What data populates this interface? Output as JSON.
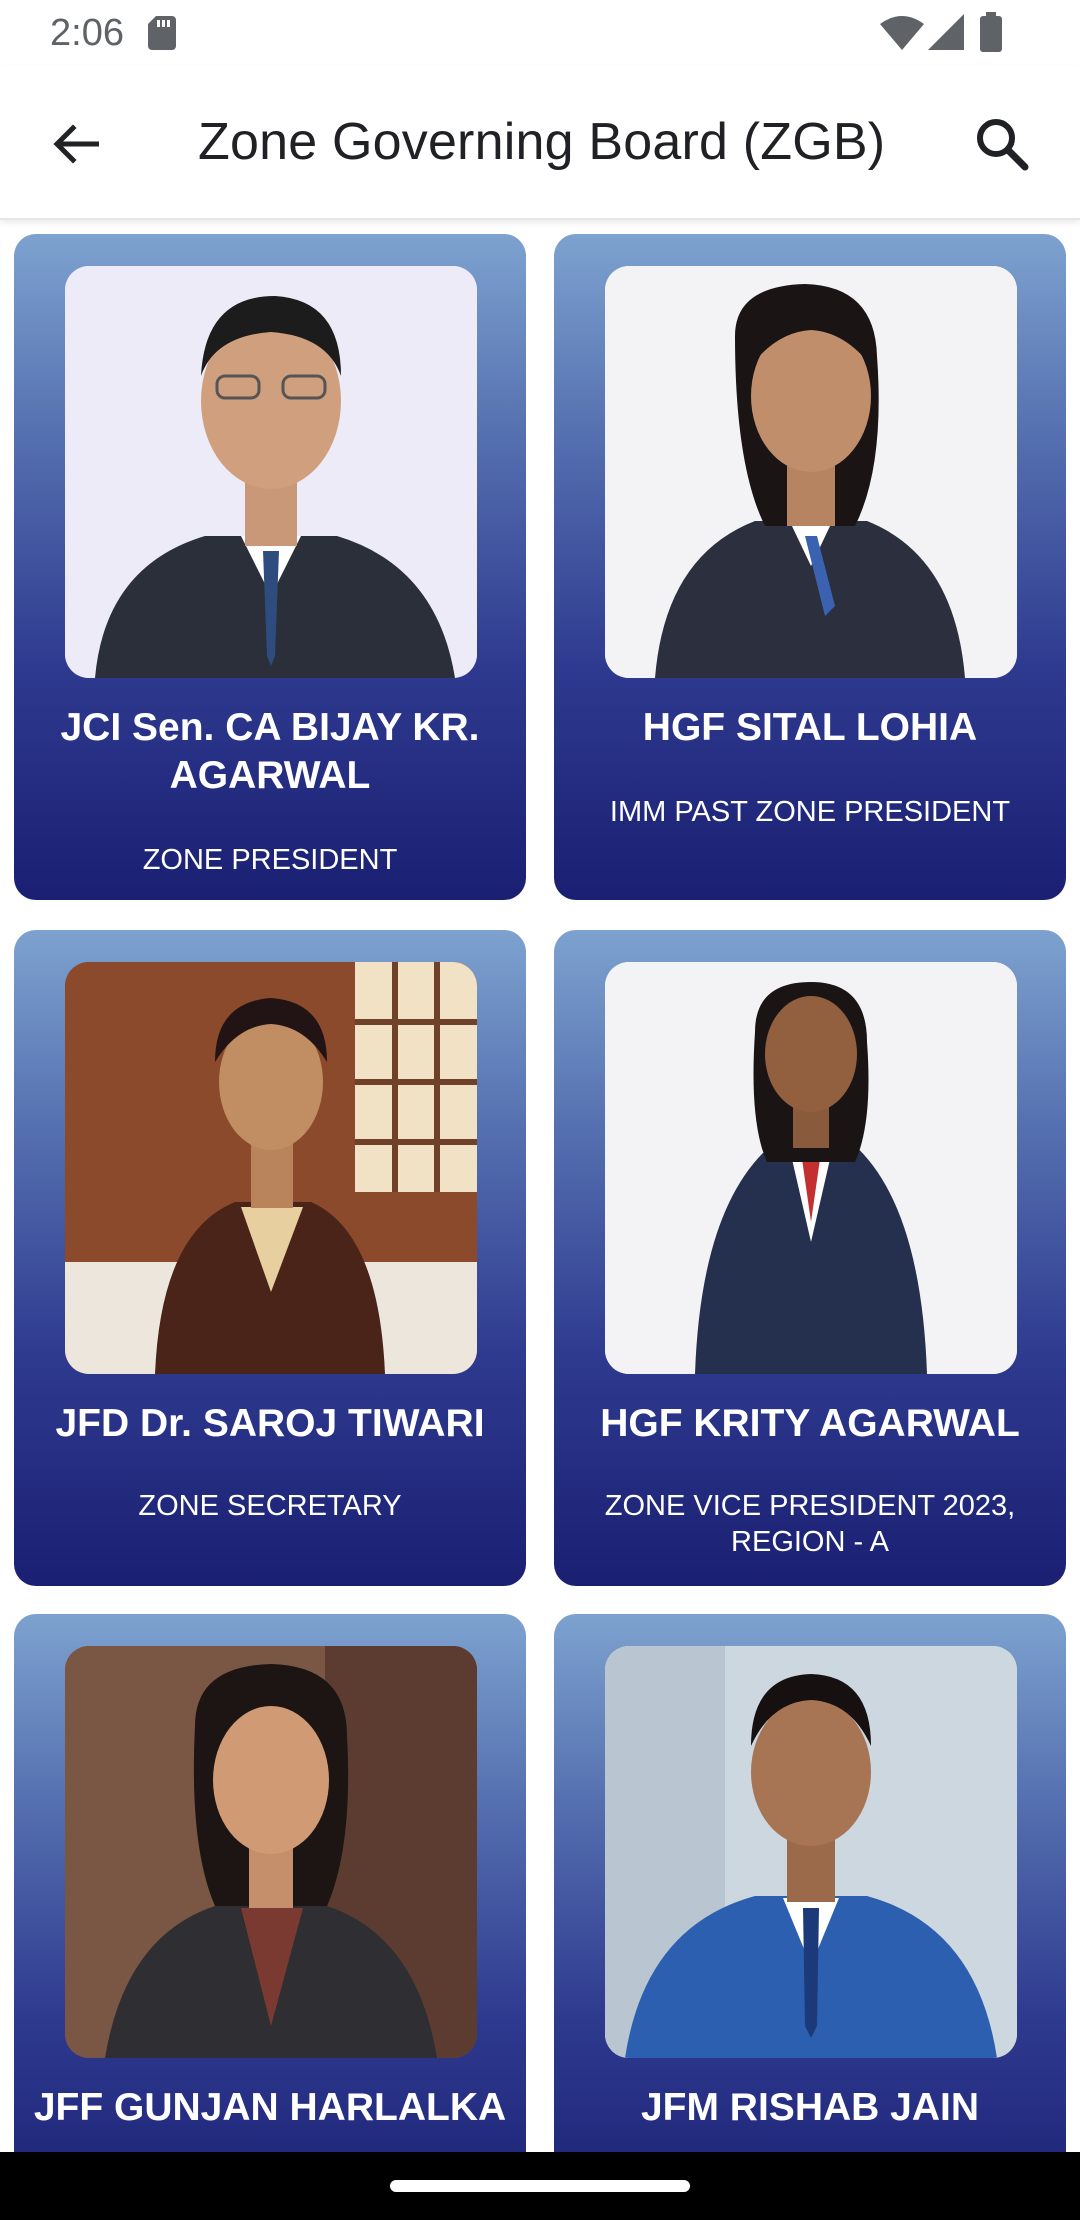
{
  "status_bar": {
    "time": "2:06",
    "icons": [
      "sd-card-icon",
      "wifi-icon",
      "signal-icon",
      "battery-icon"
    ]
  },
  "app_bar": {
    "title": "Zone Governing Board (ZGB)",
    "back_icon": "arrow-back-icon",
    "search_icon": "search-icon"
  },
  "members": [
    {
      "name": "JCI Sen. CA BIJAY KR. AGARWAL",
      "role": "ZONE PRESIDENT"
    },
    {
      "name": "HGF SITAL LOHIA",
      "role": "IMM PAST ZONE PRESIDENT"
    },
    {
      "name": "JFD Dr. SAROJ TIWARI",
      "role": "ZONE SECRETARY"
    },
    {
      "name": "HGF KRITY AGARWAL",
      "role": "ZONE VICE PRESIDENT 2023, REGION - A"
    },
    {
      "name": "JFF GUNJAN HARLALKA",
      "role": ""
    },
    {
      "name": "JFM RISHAB JAIN",
      "role": ""
    }
  ],
  "colors": {
    "card_top": "#7da2cf",
    "card_bottom": "#1a1f72",
    "text_on_card": "#ffffff"
  }
}
